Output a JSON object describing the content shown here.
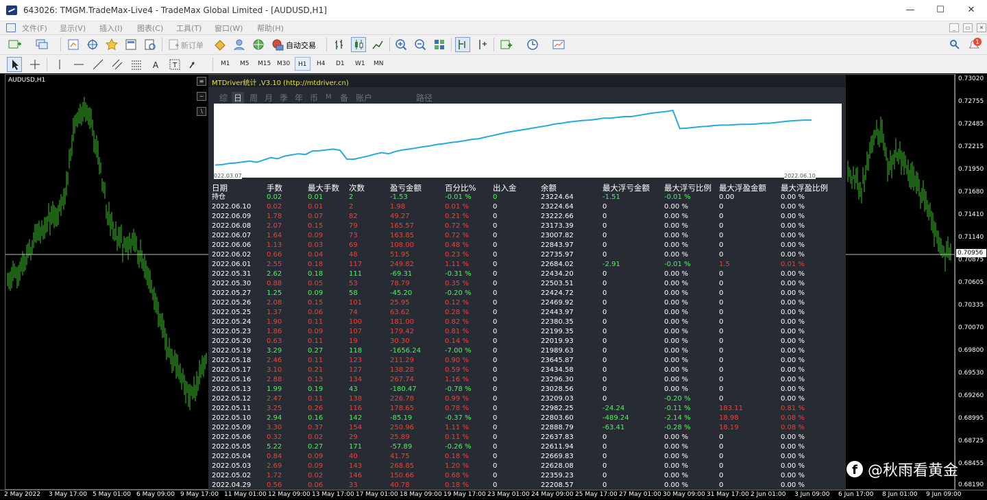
{
  "window": {
    "title": "643026: TMGM.TradeMax-Live4 - TradeMax Global Limited - [AUDUSD,H1]",
    "min": "—",
    "max": "☐",
    "close": "✕"
  },
  "menu": {
    "items": [
      "文件(F)",
      "显示(V)",
      "插入(I)",
      "图表(C)",
      "工具(T)",
      "窗口(W)",
      "帮助(H)"
    ]
  },
  "toolbar": {
    "new_order": "新订单",
    "auto_trade": "自动交易",
    "notif_count": "1"
  },
  "timeframes": [
    "M1",
    "M5",
    "M15",
    "M30",
    "H1",
    "H4",
    "D1",
    "W1",
    "MN"
  ],
  "selected_timeframe": "H1",
  "chart": {
    "symbol": "AUDUSD,H1",
    "current_price": "0.70956",
    "candle_color": "#3bbf2a"
  },
  "price_axis": [
    "0.73020",
    "0.72755",
    "0.72485",
    "0.72215",
    "0.71950",
    "0.71680",
    "0.71410",
    "0.71140",
    "0.70875",
    "0.70605",
    "0.70335",
    "0.70070",
    "0.69800",
    "0.69530",
    "0.69260",
    "0.68995",
    "0.68725",
    "0.68455",
    "0.68190"
  ],
  "time_axis": [
    "2 May 2022",
    "3 May 17:00",
    "5 May 01:00",
    "6 May 09:00",
    "9 May 17:00",
    "11 May 01:00",
    "12 May 09:00",
    "13 May 17:00",
    "17 May 01:00",
    "18 May 09:00",
    "19 May 17:00",
    "23 May 01:00",
    "24 May 09:00",
    "25 May 17:00",
    "27 May 01:00",
    "30 May 09:00",
    "31 May 17:00",
    "2 Jun 01:00",
    "3 Jun 09:00",
    "6 Jun 17:00",
    "8 Jun 01:00",
    "9 Jun 09:00"
  ],
  "panel": {
    "title": "MTDriver统计 ,V3.10 (http://mtdriver.cn)",
    "tabs": [
      "综",
      "日",
      "周",
      "月",
      "季",
      "年",
      "币",
      "M",
      "备",
      "账户",
      "路径"
    ],
    "active_tab": "日",
    "equity_start": "022.03.07",
    "equity_end": "2022.06.10",
    "equity_curve": [
      23224,
      23226,
      23232,
      23235,
      23240,
      23244,
      23238,
      23250,
      23262,
      23256,
      23270,
      23276,
      23282,
      23278,
      23296,
      23298,
      23302,
      23306,
      23300,
      23254,
      23254,
      23262,
      23270,
      23280,
      23288,
      23282,
      23294,
      23302,
      23306,
      23312,
      23318,
      23323,
      23330,
      23334,
      23340,
      23344,
      23350,
      23356,
      23360,
      23368,
      23376,
      23384,
      23392,
      23398,
      23404,
      23410,
      23416,
      23422,
      23428,
      23436,
      23440,
      23446,
      23450,
      23454,
      23456,
      23460,
      23466,
      23466,
      23470,
      23474,
      23474,
      23480,
      23486,
      23492,
      23496,
      23500,
      23506,
      23412,
      23414,
      23418,
      23422,
      23424,
      23428,
      23430,
      23430,
      23432,
      23434,
      23434,
      23436,
      23440,
      23440,
      23444,
      23448,
      23452,
      23454,
      23456,
      23456
    ],
    "headers": [
      "日期",
      "手数",
      "最大手数",
      "次数",
      "盈亏金额",
      "百分比%",
      "出入金",
      "余额",
      "最大浮亏金额",
      "最大浮亏比例",
      "最大浮盈金额",
      "最大浮盈比例"
    ],
    "hold_row": [
      "持仓",
      "0.02",
      "0.01",
      "2",
      "-1.53",
      "-0.01 %",
      "0",
      "23224.64",
      "-1.51",
      "-0.01 %",
      "0.00",
      "0.00 %"
    ],
    "rows": [
      [
        "2022.06.10",
        "0.02",
        "0.01",
        "2",
        "1.98",
        "0.01 %",
        "0",
        "23224.64",
        "0",
        "0.00 %",
        "0",
        "0.00 %"
      ],
      [
        "2022.06.09",
        "1.78",
        "0.07",
        "82",
        "49.27",
        "0.21 %",
        "0",
        "23222.66",
        "0",
        "0.00 %",
        "0",
        "0.00 %"
      ],
      [
        "2022.06.08",
        "2.07",
        "0.15",
        "79",
        "165.57",
        "0.72 %",
        "0",
        "23173.39",
        "0",
        "0.00 %",
        "0",
        "0.00 %"
      ],
      [
        "2022.06.07",
        "1.64",
        "0.09",
        "73",
        "163.85",
        "0.72 %",
        "0",
        "23007.82",
        "0",
        "0.00 %",
        "0",
        "0.00 %"
      ],
      [
        "2022.06.06",
        "1.13",
        "0.03",
        "69",
        "108.00",
        "0.48 %",
        "0",
        "22843.97",
        "0",
        "0.00 %",
        "0",
        "0.00 %"
      ],
      [
        "2022.06.02",
        "0.66",
        "0.04",
        "48",
        "51.95",
        "0.23 %",
        "0",
        "22735.97",
        "0",
        "0.00 %",
        "0",
        "0.00 %"
      ],
      [
        "2022.06.01",
        "2.55",
        "0.18",
        "117",
        "249.82",
        "1.11 %",
        "0",
        "22684.02",
        "-2.91",
        "-0.01 %",
        "1.5",
        "0.01 %"
      ],
      [
        "2022.05.31",
        "2.62",
        "0.18",
        "111",
        "-69.31",
        "-0.31 %",
        "0",
        "22434.20",
        "0",
        "0.00 %",
        "0",
        "0.00 %"
      ],
      [
        "2022.05.30",
        "0.88",
        "0.05",
        "53",
        "78.79",
        "0.35 %",
        "0",
        "22503.51",
        "0",
        "0.00 %",
        "0",
        "0.00 %"
      ],
      [
        "2022.05.27",
        "1.25",
        "0.09",
        "58",
        "-45.20",
        "-0.20 %",
        "0",
        "22424.72",
        "0",
        "0.00 %",
        "0",
        "0.00 %"
      ],
      [
        "2022.05.26",
        "2.08",
        "0.15",
        "101",
        "25.95",
        "0.12 %",
        "0",
        "22469.92",
        "0",
        "0.00 %",
        "0",
        "0.00 %"
      ],
      [
        "2022.05.25",
        "1.37",
        "0.06",
        "74",
        "63.62",
        "0.28 %",
        "0",
        "22443.97",
        "0",
        "0.00 %",
        "0",
        "0.00 %"
      ],
      [
        "2022.05.24",
        "1.90",
        "0.11",
        "100",
        "181.00",
        "0.82 %",
        "0",
        "22380.35",
        "0",
        "0.00 %",
        "0",
        "0.00 %"
      ],
      [
        "2022.05.23",
        "1.86",
        "0.09",
        "107",
        "179.42",
        "0.81 %",
        "0",
        "22199.35",
        "0",
        "0.00 %",
        "0",
        "0.00 %"
      ],
      [
        "2022.05.20",
        "0.63",
        "0.11",
        "19",
        "30.30",
        "0.14 %",
        "0",
        "22019.93",
        "0",
        "0.00 %",
        "0",
        "0.00 %"
      ],
      [
        "2022.05.19",
        "3.29",
        "0.27",
        "118",
        "-1656.24",
        "-7.00 %",
        "0",
        "21989.63",
        "0",
        "0.00 %",
        "0",
        "0.00 %"
      ],
      [
        "2022.05.18",
        "2.46",
        "0.11",
        "123",
        "211.29",
        "0.90 %",
        "0",
        "23645.87",
        "0",
        "0.00 %",
        "0",
        "0.00 %"
      ],
      [
        "2022.05.17",
        "3.10",
        "0.21",
        "127",
        "138.28",
        "0.59 %",
        "0",
        "23434.58",
        "0",
        "0.00 %",
        "0",
        "0.00 %"
      ],
      [
        "2022.05.16",
        "2.88",
        "0.13",
        "134",
        "267.74",
        "1.16 %",
        "0",
        "23296.30",
        "0",
        "0.00 %",
        "0",
        "0.00 %"
      ],
      [
        "2022.05.13",
        "1.99",
        "0.19",
        "43",
        "-180.47",
        "-0.78 %",
        "0",
        "23028.56",
        "0",
        "0.00 %",
        "0",
        "0.00 %"
      ],
      [
        "2022.05.12",
        "2.47",
        "0.11",
        "138",
        "226.78",
        "0.99 %",
        "0",
        "23209.03",
        "0",
        "-0.20 %",
        "0",
        "0.00 %"
      ],
      [
        "2022.05.11",
        "3.25",
        "0.26",
        "116",
        "178.65",
        "0.78 %",
        "0",
        "22982.25",
        "-24.24",
        "-0.11 %",
        "183.11",
        "0.81 %"
      ],
      [
        "2022.05.10",
        "2.94",
        "0.16",
        "142",
        "-85.19",
        "-0.37 %",
        "0",
        "22803.60",
        "-489.24",
        "-2.14 %",
        "18.98",
        "0.08 %"
      ],
      [
        "2022.05.09",
        "3.30",
        "0.37",
        "154",
        "250.96",
        "1.11 %",
        "0",
        "22888.79",
        "-63.41",
        "-0.28 %",
        "18.19",
        "0.08 %"
      ],
      [
        "2022.05.06",
        "0.32",
        "0.02",
        "29",
        "25.89",
        "0.11 %",
        "0",
        "22637.83",
        "0",
        "0.00 %",
        "0",
        "0.00 %"
      ],
      [
        "2022.05.05",
        "5.22",
        "0.27",
        "171",
        "-57.89",
        "-0.26 %",
        "0",
        "22611.94",
        "0",
        "0.00 %",
        "0",
        "0.00 %"
      ],
      [
        "2022.05.04",
        "0.84",
        "0.09",
        "40",
        "41.75",
        "0.18 %",
        "0",
        "22669.83",
        "0",
        "0.00 %",
        "0",
        "0.00 %"
      ],
      [
        "2022.05.03",
        "2.69",
        "0.09",
        "143",
        "268.85",
        "1.20 %",
        "0",
        "22628.08",
        "0",
        "0.00 %",
        "0",
        "0.00 %"
      ],
      [
        "2022.05.02",
        "1.72",
        "0.02",
        "146",
        "150.66",
        "0.68 %",
        "0",
        "22359.23",
        "0",
        "0.00 %",
        "0",
        "0.00 %"
      ],
      [
        "2022.04.29",
        "0.56",
        "0.06",
        "33",
        "40.78",
        "0.18 %",
        "0",
        "22208.57",
        "0",
        "0.00 %",
        "0",
        "0.00 %"
      ]
    ]
  },
  "watermark": "@秋雨看黄金"
}
